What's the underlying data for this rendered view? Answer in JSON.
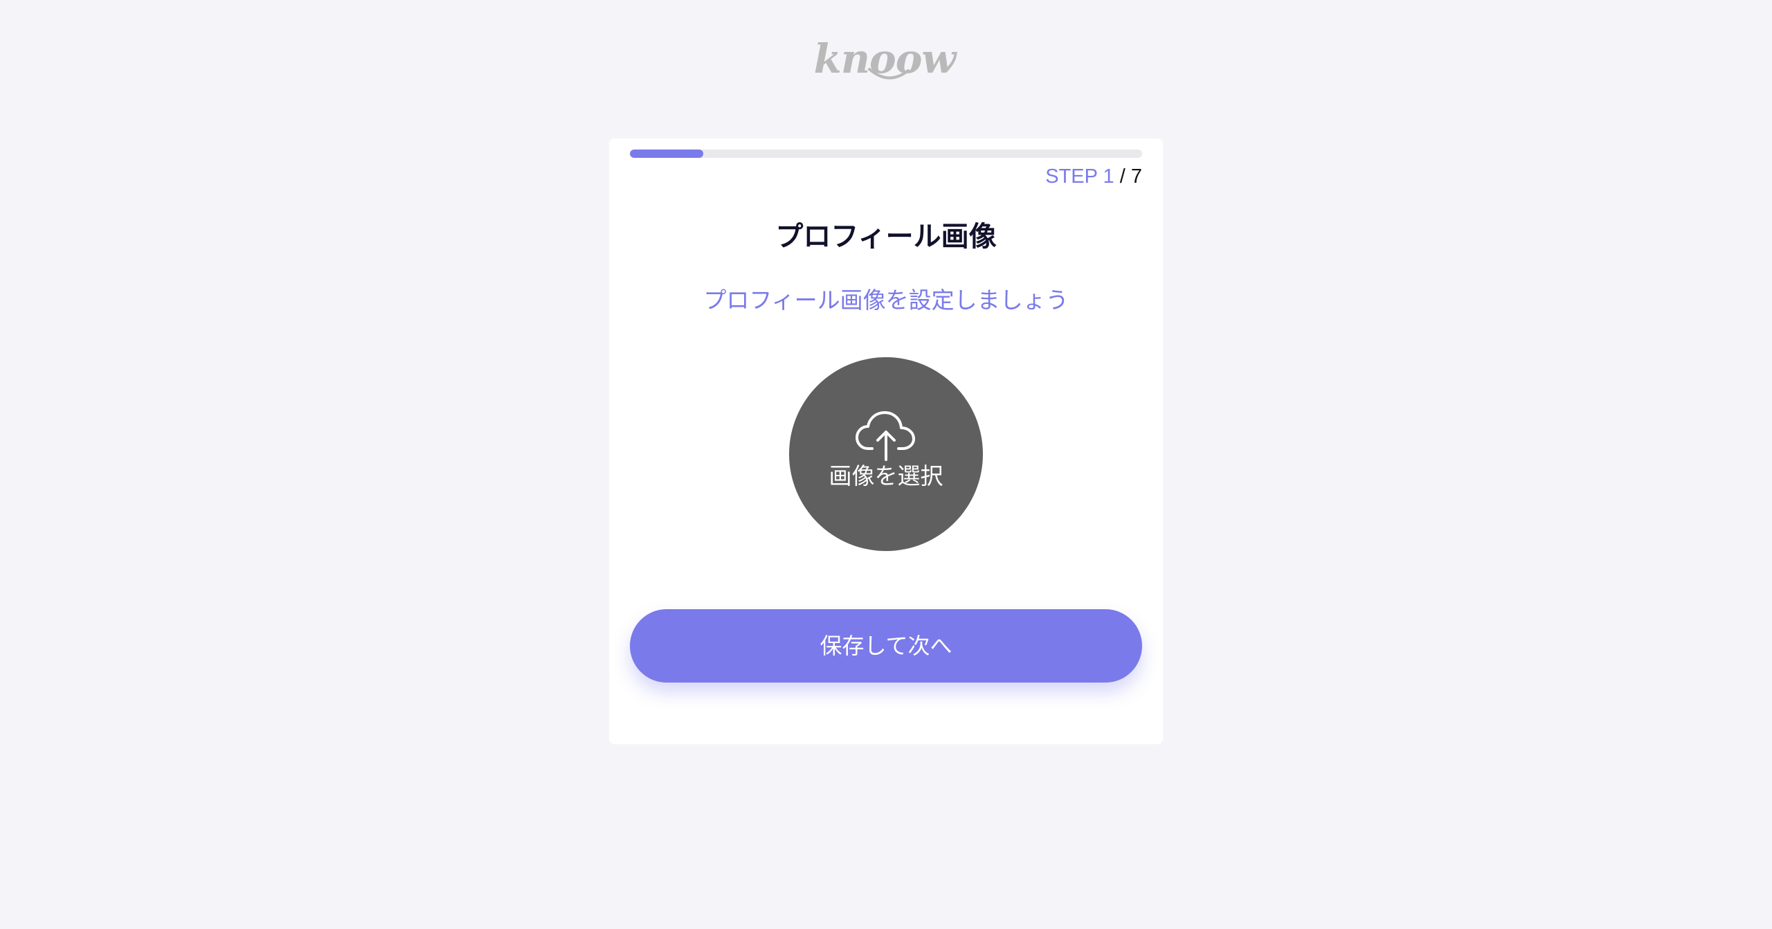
{
  "logo": {
    "text": "knoow"
  },
  "progress": {
    "current_step": 1,
    "total_steps": 7,
    "fraction": 0.143,
    "step_prefix": "STEP",
    "step_current": "1",
    "step_separator": "/",
    "step_total": "7"
  },
  "header": {
    "title": "プロフィール画像",
    "subtitle": "プロフィール画像を設定しましょう"
  },
  "avatar": {
    "icon": "cloud-upload-icon",
    "choose_label": "画像を選択"
  },
  "actions": {
    "save_next_label": "保存して次へ"
  },
  "colors": {
    "accent": "#7a7aea",
    "background": "#f5f5f9",
    "card": "#ffffff",
    "avatar_bg": "#5f5f5f",
    "track": "#e9e9ec",
    "title": "#11112b"
  }
}
